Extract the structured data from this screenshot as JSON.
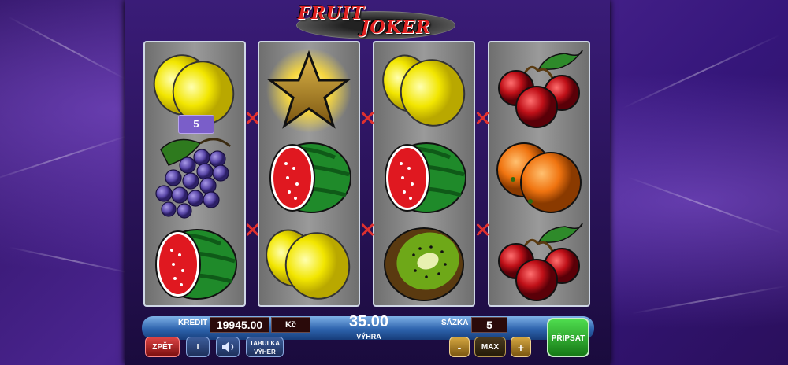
{
  "title": {
    "fruit": "FRUIT",
    "joker": "JOKER"
  },
  "reels": [
    {
      "symbols": [
        "lemon-icon",
        "grape-icon",
        "watermelon-icon"
      ]
    },
    {
      "symbols": [
        "star-icon",
        "watermelon-icon",
        "lemon-icon"
      ]
    },
    {
      "symbols": [
        "lemon-icon",
        "watermelon-icon",
        "kiwi-icon"
      ]
    },
    {
      "symbols": [
        "cherry-icon",
        "orange-icon",
        "cherry-icon"
      ]
    }
  ],
  "line_badge": "5",
  "panel": {
    "credit_label": "KREDIT",
    "credit_value": "19945.00",
    "currency": "Kč",
    "win_value": "35.00",
    "win_label": "VÝHRA",
    "bet_label": "SÁZKA",
    "bet_value": "5",
    "back_label": "ZPĚT",
    "info_label": "I",
    "paytable_label_1": "TABULKA",
    "paytable_label_2": "VÝHER",
    "minus_label": "-",
    "max_label": "MAX",
    "plus_label": "+",
    "spin_label": "PŘIPSAT"
  },
  "colors": {
    "accent_red": "#e0302e",
    "spin_green": "#2fb82f",
    "panel_blue": "#2d63ad"
  }
}
